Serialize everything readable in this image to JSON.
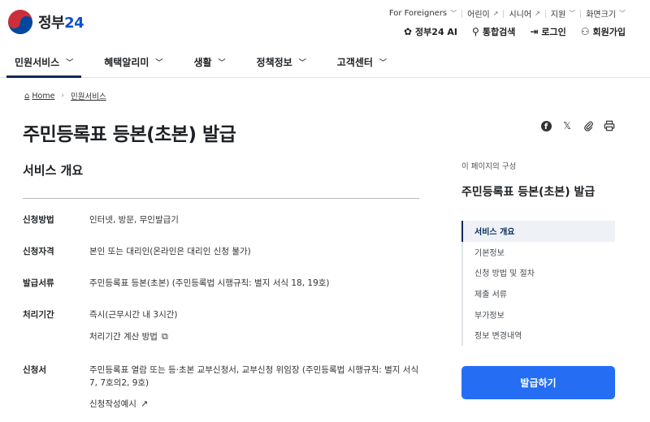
{
  "logo": {
    "text_a": "정부",
    "text_b": "24"
  },
  "utility": [
    {
      "label": "For Foreigners",
      "icon": "chevron-down-icon",
      "glyph": "﹀"
    },
    {
      "label": "어린이",
      "icon": "external-link-icon",
      "glyph": "↗"
    },
    {
      "label": "시니어",
      "icon": "external-link-icon",
      "glyph": "↗"
    },
    {
      "label": "지원",
      "icon": "chevron-down-icon",
      "glyph": "﹀"
    },
    {
      "label": "화면크기",
      "icon": "chevron-down-icon",
      "glyph": "﹀"
    }
  ],
  "quick": [
    {
      "label": "정부24 AI",
      "icon": "ai-icon",
      "glyph": "✿"
    },
    {
      "label": "통합검색",
      "icon": "search-icon",
      "glyph": "⚲"
    },
    {
      "label": "로그인",
      "icon": "login-icon",
      "glyph": "⇥"
    },
    {
      "label": "회원가입",
      "icon": "user-plus-icon",
      "glyph": "⚇"
    }
  ],
  "nav": [
    {
      "label": "민원서비스"
    },
    {
      "label": "혜택알리미"
    },
    {
      "label": "생활"
    },
    {
      "label": "정책정보"
    },
    {
      "label": "고객센터"
    }
  ],
  "breadcrumb": {
    "home": "Home",
    "current": "민원서비스"
  },
  "page_title": "주민등록표 등본(초본) 발급",
  "section_title": "서비스 개요",
  "rows": [
    {
      "key": "신청방법",
      "value": "인터넷, 방문, 무인발급기"
    },
    {
      "key": "신청자격",
      "value": "본인 또는 대리인(온라인은 대리인 신청 불가)"
    },
    {
      "key": "발급서류",
      "value": "주민등록표 등본(초본) (주민등록법 시행규칙: 별지 서식 18, 19호)"
    },
    {
      "key": "처리기간",
      "value": "즉시(근무시간 내 3시간)",
      "sub": "처리기간 계산 방법"
    },
    {
      "key": "신청서",
      "value": "주민등록표 열람 또는 등·초본 교부신청서, 교부신청 위임장 (주민등록법 시행규칙: 별지 서식 7, 7호의2, 9호)",
      "sub": "신청작성예시"
    }
  ],
  "sidebar": {
    "hint": "이 페이지의 구성",
    "title": "주민등록표 등본(초본) 발급",
    "toc": [
      "서비스 개요",
      "기본정보",
      "신청 방법 및 절차",
      "제출 서류",
      "부가정보",
      "정보 변경내역"
    ],
    "button": "발급하기"
  },
  "colors": {
    "primary": "#256ef4",
    "nav_active": "#052b57"
  }
}
